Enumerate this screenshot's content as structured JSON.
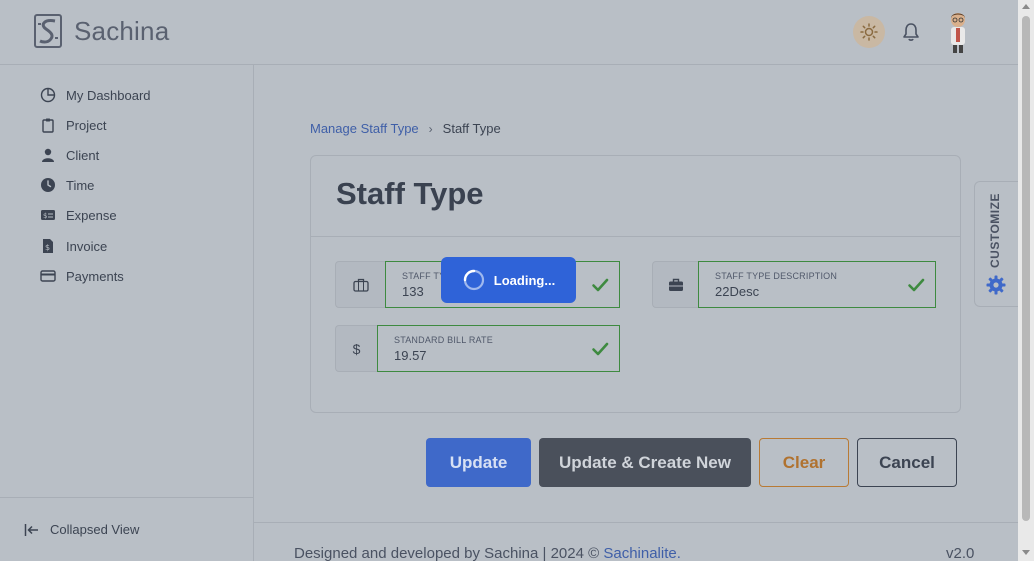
{
  "app": {
    "brand": "Sachina"
  },
  "sidebar": {
    "items": [
      {
        "label": "My Dashboard",
        "icon": "pie-chart-icon"
      },
      {
        "label": "Project",
        "icon": "clipboard-icon"
      },
      {
        "label": "Client",
        "icon": "user-icon"
      },
      {
        "label": "Time",
        "icon": "clock-icon"
      },
      {
        "label": "Expense",
        "icon": "money-card-icon"
      },
      {
        "label": "Invoice",
        "icon": "invoice-icon"
      },
      {
        "label": "Payments",
        "icon": "credit-card-icon"
      }
    ],
    "collapse_label": "Collapsed View"
  },
  "breadcrumb": {
    "parent": "Manage Staff Type",
    "separator": "›",
    "current": "Staff Type"
  },
  "form": {
    "title": "Staff Type",
    "fields": {
      "staff_type": {
        "label": "STAFF TY",
        "value": "133"
      },
      "description": {
        "label": "STAFF TYPE DESCRIPTION",
        "value": "22Desc"
      },
      "bill_rate": {
        "label": "STANDARD BILL RATE",
        "value": "19.57",
        "addon": "$"
      }
    },
    "loading_text": "Loading..."
  },
  "buttons": {
    "update": "Update",
    "update_create": "Update & Create New",
    "clear": "Clear",
    "cancel": "Cancel"
  },
  "customize": {
    "label": "CUSTOMIZE"
  },
  "footer": {
    "text": "Designed and developed by Sachina | 2024 © ",
    "link": "Sachinalite.",
    "version": "v2.0"
  },
  "colors": {
    "accent": "#3f69c9",
    "success": "#3e8a40",
    "loading": "#2f63d8",
    "warning": "#b0722f"
  }
}
